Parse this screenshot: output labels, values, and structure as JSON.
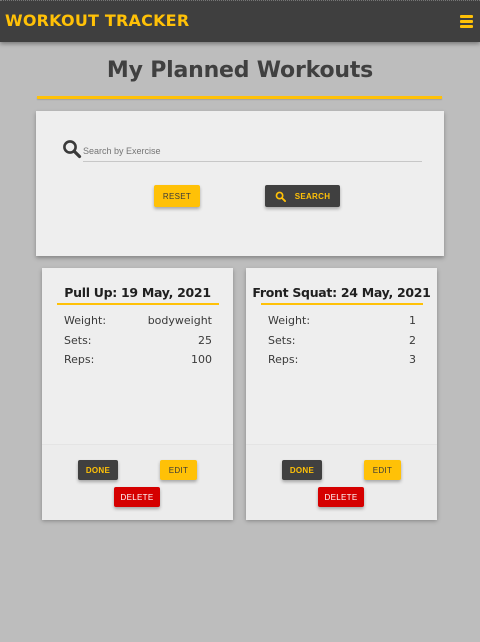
{
  "app": {
    "brand": "WORKOUT TRACKER"
  },
  "page": {
    "title": "My Planned Workouts"
  },
  "search": {
    "placeholder": "Search by Exercise",
    "value": "",
    "reset_label": "RESET",
    "search_label": "SEARCH"
  },
  "workouts": [
    {
      "title": "Pull Up: 19 May, 2021",
      "weight_label": "Weight:",
      "weight": "bodyweight",
      "sets_label": "Sets:",
      "sets": "25",
      "reps_label": "Reps:",
      "reps": "100",
      "done_label": "DONE",
      "edit_label": "EDIT",
      "delete_label": "DELETE"
    },
    {
      "title": "Front Squat: 24 May, 2021",
      "weight_label": "Weight:",
      "weight": "1",
      "sets_label": "Sets:",
      "sets": "2",
      "reps_label": "Reps:",
      "reps": "3",
      "done_label": "DONE",
      "edit_label": "EDIT",
      "delete_label": "DELETE"
    }
  ],
  "colors": {
    "accent": "#ffc107",
    "dark": "#404040",
    "danger": "#d50000",
    "background": "#bdbdbd",
    "panel": "#eeeeee"
  },
  "icons": {
    "menu": "hamburger-menu-icon",
    "search": "search-icon"
  }
}
